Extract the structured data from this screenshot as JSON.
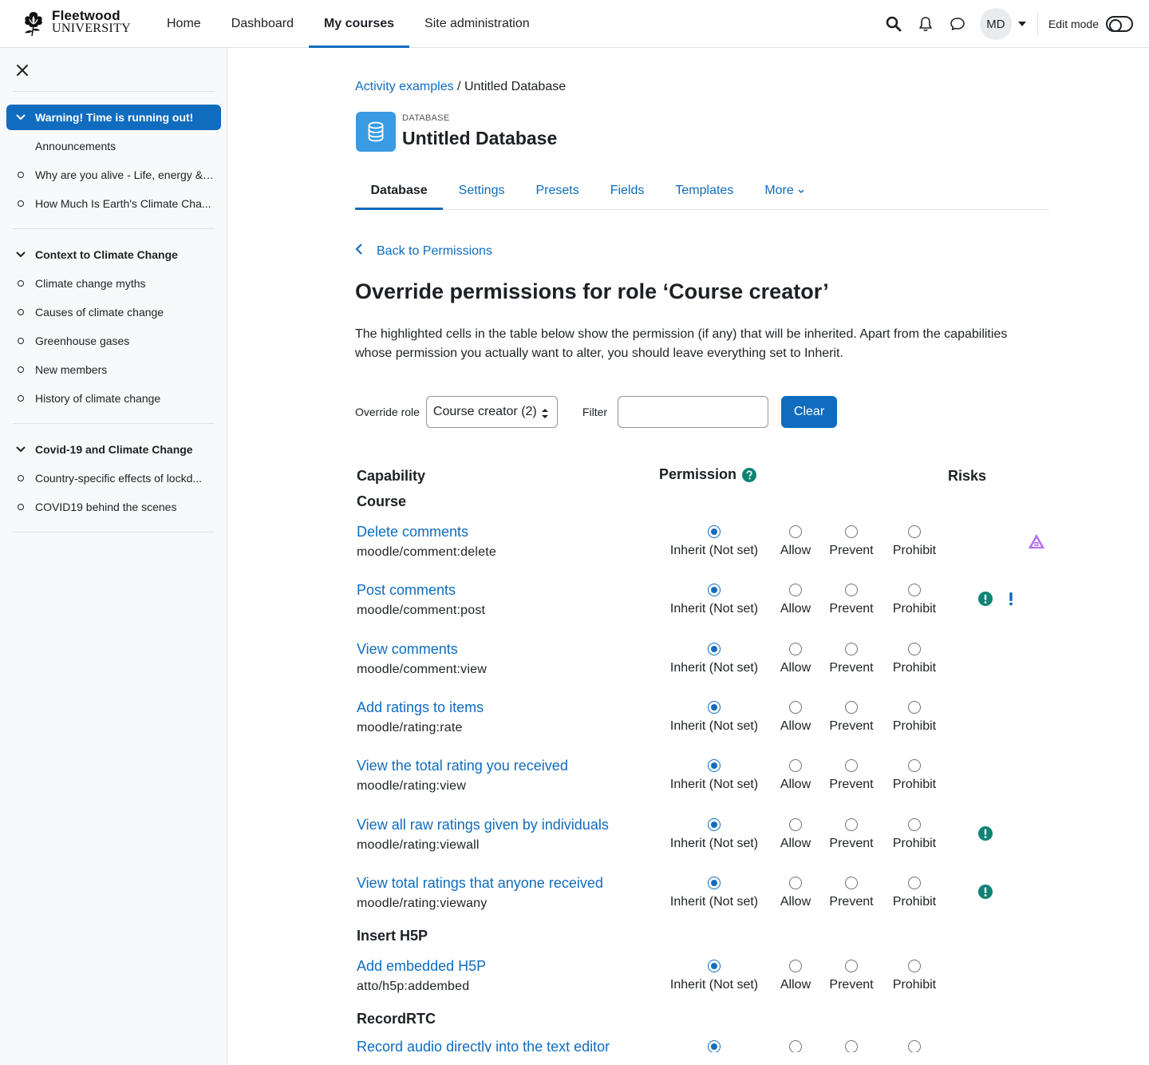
{
  "brand": {
    "line1": "Fleetwood",
    "line2": "UNIVERSITY"
  },
  "nav": {
    "items": [
      "Home",
      "Dashboard",
      "My courses",
      "Site administration"
    ],
    "active_index": 2,
    "avatar_initials": "MD",
    "edit_mode_label": "Edit mode"
  },
  "drawer": {
    "sections": [
      {
        "title": "Warning! Time is running out!",
        "active": true,
        "items": [
          {
            "label": "Announcements",
            "bullet": false
          },
          {
            "label": "Why are you alive - Life, energy & ...",
            "bullet": true
          },
          {
            "label": "How Much Is Earth's Climate Cha...",
            "bullet": true
          }
        ]
      },
      {
        "title": "Context to Climate Change",
        "active": false,
        "items": [
          {
            "label": "Climate change myths",
            "bullet": true
          },
          {
            "label": "Causes of climate change",
            "bullet": true
          },
          {
            "label": "Greenhouse gases",
            "bullet": true
          },
          {
            "label": "New members",
            "bullet": true
          },
          {
            "label": "History of climate change",
            "bullet": true
          }
        ]
      },
      {
        "title": "Covid-19 and Climate Change",
        "active": false,
        "items": [
          {
            "label": "Country-specific effects of lockd...",
            "bullet": true
          },
          {
            "label": "COVID19 behind the scenes",
            "bullet": true
          }
        ]
      }
    ]
  },
  "breadcrumb": {
    "parent": "Activity examples",
    "separator": " / ",
    "current": "Untitled Database"
  },
  "activity": {
    "type": "DATABASE",
    "title": "Untitled Database"
  },
  "tabs": [
    "Database",
    "Settings",
    "Presets",
    "Fields",
    "Templates",
    "More"
  ],
  "back_link": "Back to Permissions",
  "heading": "Override permissions for role ‘Course creator’",
  "intro": "The highlighted cells in the table below show the permission (if any) that will be inherited. Apart from the capabilities whose permission you actually want to alter, you should leave everything set to Inherit.",
  "controls": {
    "override_role_label": "Override role",
    "override_role_value": "Course creator (2)",
    "filter_label": "Filter",
    "filter_value": "",
    "clear_label": "Clear"
  },
  "table": {
    "headers": {
      "capability": "Capability",
      "permission": "Permission",
      "risks": "Risks"
    },
    "permission_options": [
      "Inherit (Not set)",
      "Allow",
      "Prevent",
      "Prohibit"
    ],
    "groups": [
      {
        "name": "Course",
        "rows": [
          {
            "name": "Delete comments",
            "code": "moodle/comment:delete",
            "selected": 0,
            "risks": [
              "data-loss"
            ]
          },
          {
            "name": "Post comments",
            "code": "moodle/comment:post",
            "selected": 0,
            "risks": [
              "privacy",
              "spam"
            ]
          },
          {
            "name": "View comments",
            "code": "moodle/comment:view",
            "selected": 0,
            "risks": []
          },
          {
            "name": "Add ratings to items",
            "code": "moodle/rating:rate",
            "selected": 0,
            "risks": []
          },
          {
            "name": "View the total rating you received",
            "code": "moodle/rating:view",
            "selected": 0,
            "risks": []
          },
          {
            "name": "View all raw ratings given by individuals",
            "code": "moodle/rating:viewall",
            "selected": 0,
            "risks": [
              "privacy"
            ]
          },
          {
            "name": "View total ratings that anyone received",
            "code": "moodle/rating:viewany",
            "selected": 0,
            "risks": [
              "privacy"
            ]
          }
        ]
      },
      {
        "name": "Insert H5P",
        "rows": [
          {
            "name": "Add embedded H5P",
            "code": "atto/h5p:addembed",
            "selected": 0,
            "risks": []
          }
        ]
      },
      {
        "name": "RecordRTC",
        "rows": [
          {
            "name": "Record audio directly into the text editor",
            "code": "",
            "selected": 0,
            "risks": []
          }
        ]
      }
    ]
  },
  "colors": {
    "primary": "#0f6cbf",
    "risk_privacy": "#0e8476",
    "risk_spam": "#0f6cbf",
    "risk_dataloss": "#b26cf5"
  }
}
